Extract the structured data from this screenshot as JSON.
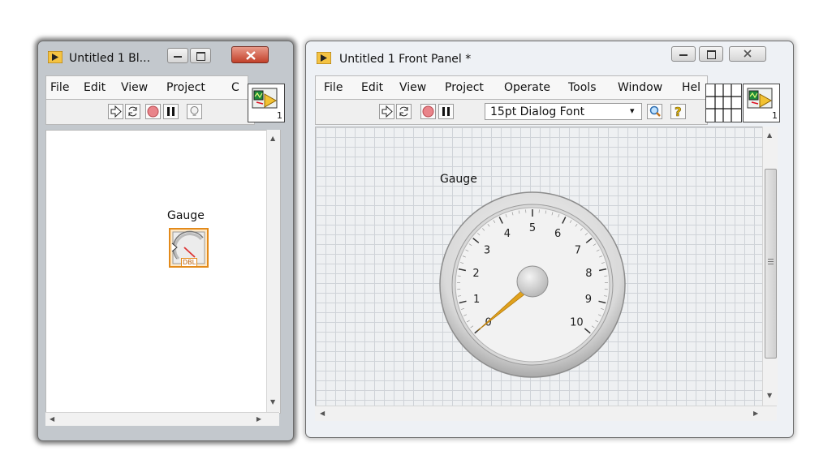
{
  "block_diagram": {
    "title": "Untitled 1 Bl...",
    "menus": [
      "File",
      "Edit",
      "View",
      "Project",
      "C"
    ],
    "terminal_label": "Gauge",
    "terminal_type": "DBL",
    "connector_number": "1"
  },
  "front_panel": {
    "title": "Untitled 1 Front Panel *",
    "menus": [
      "File",
      "Edit",
      "View",
      "Project",
      "Operate",
      "Tools",
      "Window",
      "Hel"
    ],
    "font_selector": "15pt Dialog Font",
    "connector_number": "1",
    "gauge": {
      "label": "Gauge",
      "value": 0,
      "scale_min": 0,
      "scale_max": 10,
      "tick_labels": [
        "0",
        "1",
        "2",
        "3",
        "4",
        "5",
        "6",
        "7",
        "8",
        "9",
        "10"
      ]
    }
  },
  "colors": {
    "needle": "#e0a21e",
    "terminal_border": "#e38a1a",
    "grid_line": "#cfd3d8",
    "grid_bg": "#eef0f2"
  }
}
